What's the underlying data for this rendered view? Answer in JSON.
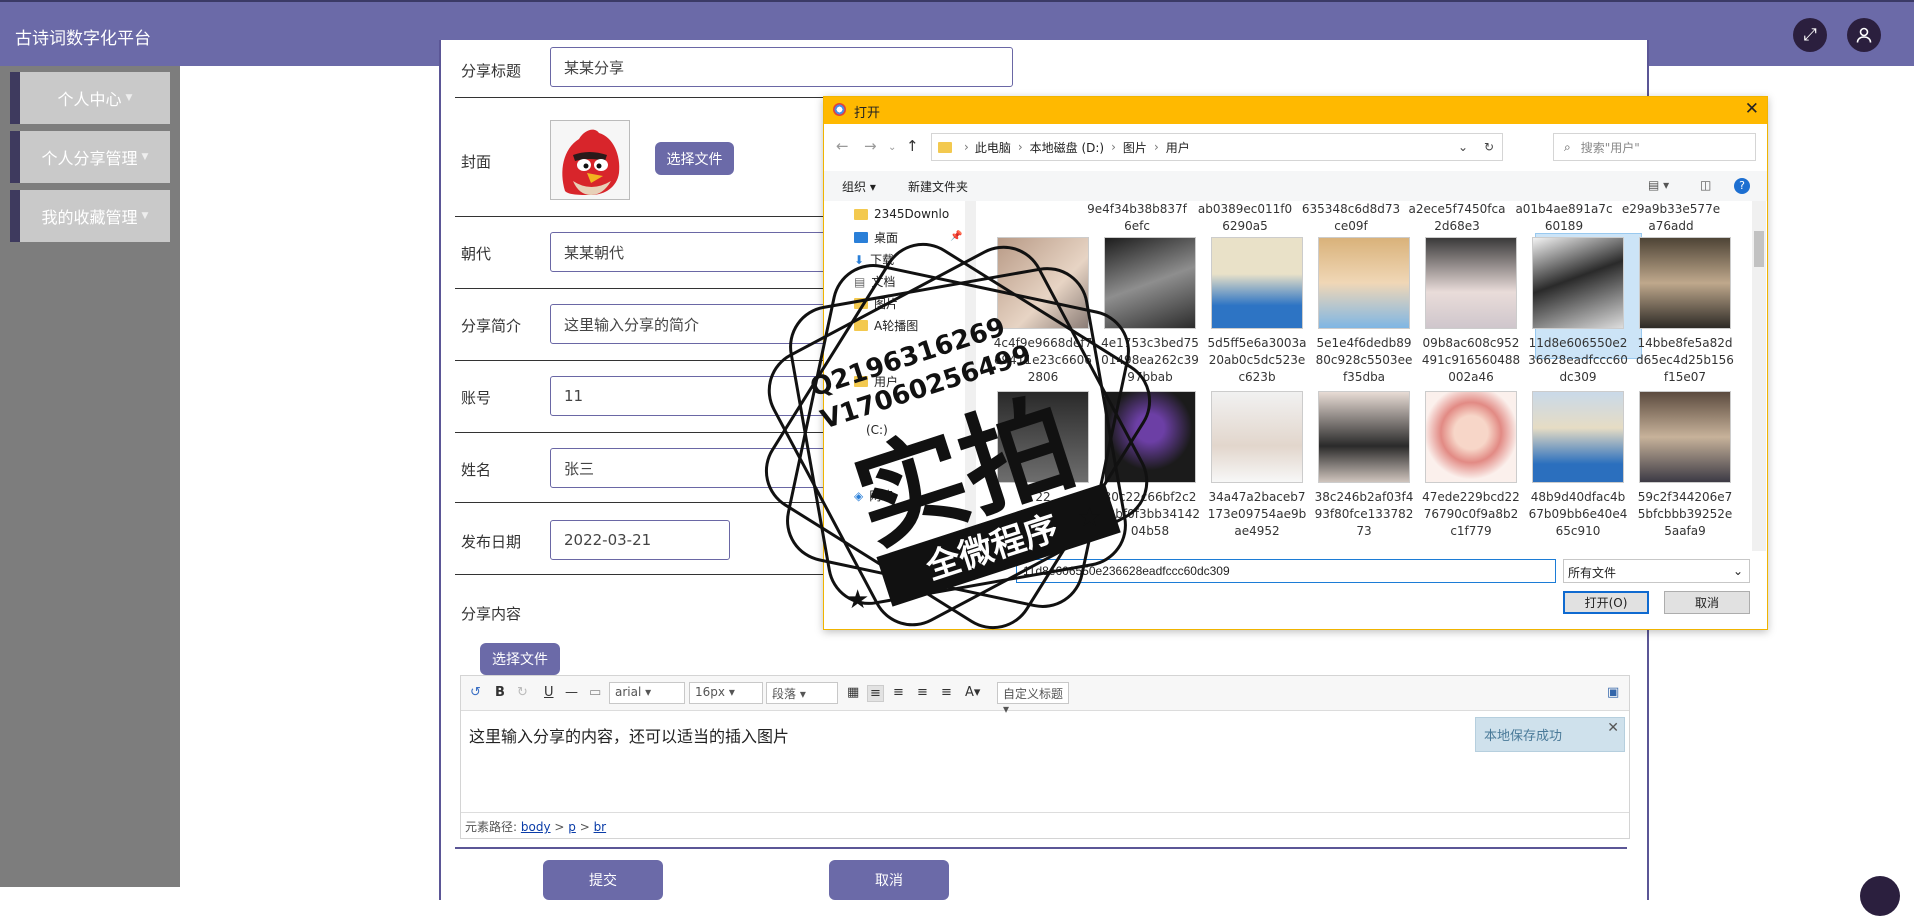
{
  "header": {
    "title": "古诗词数字化平台"
  },
  "sidebar": {
    "items": [
      {
        "label": "个人中心"
      },
      {
        "label": "个人分享管理"
      },
      {
        "label": "我的收藏管理"
      }
    ]
  },
  "form": {
    "title_label": "分享标题",
    "title_value": "某某分享",
    "cover_label": "封面",
    "choose_file": "选择文件",
    "dynasty_label": "朝代",
    "dynasty_value": "某某朝代",
    "intro_label": "分享简介",
    "intro_value": "这里输入分享的简介",
    "account_label": "账号",
    "account_value": "11",
    "name_label": "姓名",
    "name_value": "张三",
    "date_label": "发布日期",
    "date_value": "2022-03-21",
    "content_label": "分享内容",
    "content_choose_file": "选择文件",
    "submit": "提交",
    "cancel": "取消"
  },
  "editor": {
    "font": "arial",
    "size": "16px",
    "para": "段落",
    "custom": "自定义标题",
    "body_text": "这里输入分享的内容，还可以适当的插入图片",
    "path_label": "元素路径:",
    "path_body": "body",
    "path_p": "p",
    "path_br": "br",
    "toast": "本地保存成功"
  },
  "dialog": {
    "title": "打开",
    "breadcrumb": [
      "此电脑",
      "本地磁盘 (D:)",
      "图片",
      "用户"
    ],
    "search_placeholder": "搜索\"用户\"",
    "organize": "组织 ▾",
    "new_folder": "新建文件夹",
    "tree": [
      "2345Downlo",
      "桌面",
      "下载",
      "文档",
      "图片",
      "A轮播图",
      "用户",
      "(C:)",
      "网络"
    ],
    "top_row": [
      "9e4f34b38b837f6efc",
      "ab0389ec011f06290a5",
      "635348c6d8d73ce09f",
      "a2ece5f7450fca2d68e3",
      "a01b4ae891a7c60189",
      "e29a9b33e577ea76add"
    ],
    "row1": [
      "4c4f9e9668def7e9411e23c66062806",
      "4e1753c3bed7501498ea262c3997bbab",
      "5d5ff5e6a3003a20ab0c5dc523ec623b",
      "5e1e4f6dedb8980c928c5503eef35dba",
      "09b8ac608c952491c916560488002a46",
      "11d8e606550e236628eadfccc60dc309",
      "14bbe8fe5a82dd65ec4d25b156f15e07"
    ],
    "row2": [
      "22",
      "30c22c66bf2c292bf0f3bb3414204b58",
      "34a47a2baceb7173e09754ae9bae4952",
      "38c246b2af03f493f80fce13378273",
      "47ede229bcd2276790c0f9a8b2c1f779",
      "48b9d40dfac4b67b09bb6e40e465c910",
      "59c2f344206e75bfcbbb39252e5aafa9"
    ],
    "filename": "11d8e606550e236628eadfccc60dc309",
    "filetype": "所有文件",
    "open_btn": "打开(O)",
    "cancel_btn": "取消"
  },
  "watermark": {
    "line1": "Q2196316269",
    "line2": "V17060256499",
    "big": "实拍",
    "banner": "全微程序"
  }
}
